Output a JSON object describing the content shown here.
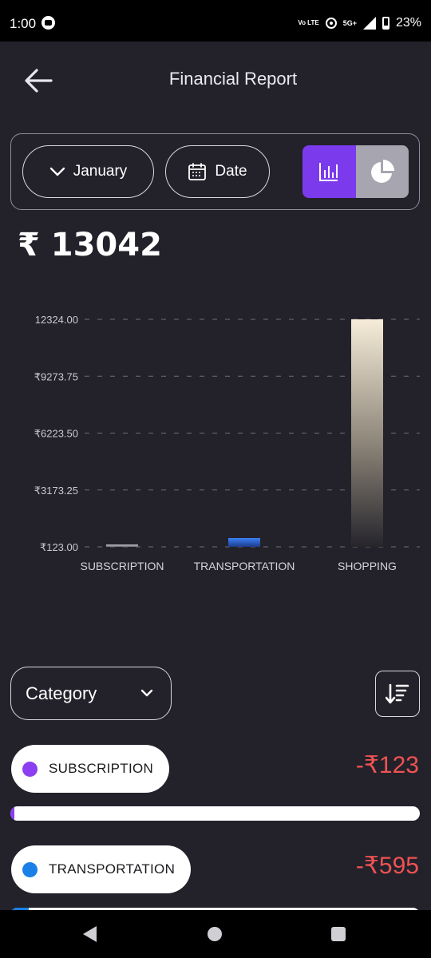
{
  "status_bar": {
    "time": "1:00",
    "volte_label": "Vo LTE",
    "network": "5G+",
    "battery": "23%"
  },
  "header": {
    "title": "Financial Report",
    "back_icon": "arrow-left-icon"
  },
  "filters": {
    "month_label": "January",
    "date_label": "Date",
    "view_mode": "bar",
    "accent_color": "#7c3aed"
  },
  "total": {
    "amount": "₹ 13042"
  },
  "chart_data": {
    "type": "bar",
    "categories": [
      "SUBSCRIPTION",
      "TRANSPORTATION",
      "SHOPPING"
    ],
    "values": [
      123,
      595,
      12324
    ],
    "ylim": [
      123,
      12324
    ],
    "y_tick_labels": [
      "12324.00",
      "₹9273.75",
      "₹6223.50",
      "₹3173.25",
      "₹123.00"
    ],
    "grid": true,
    "bar_colors": [
      "#9b9ba3",
      "#2563eb",
      "#f3e8d4"
    ]
  },
  "list_controls": {
    "category_label": "Category",
    "sort_icon": "sort-descending-icon"
  },
  "transactions": [
    {
      "category": "SUBSCRIPTION",
      "amount": "-₹123",
      "color": "#8b3ff0",
      "share": 0.0094
    },
    {
      "category": "TRANSPORTATION",
      "amount": "-₹595",
      "color": "#1a7fe6",
      "share": 0.0456
    }
  ]
}
